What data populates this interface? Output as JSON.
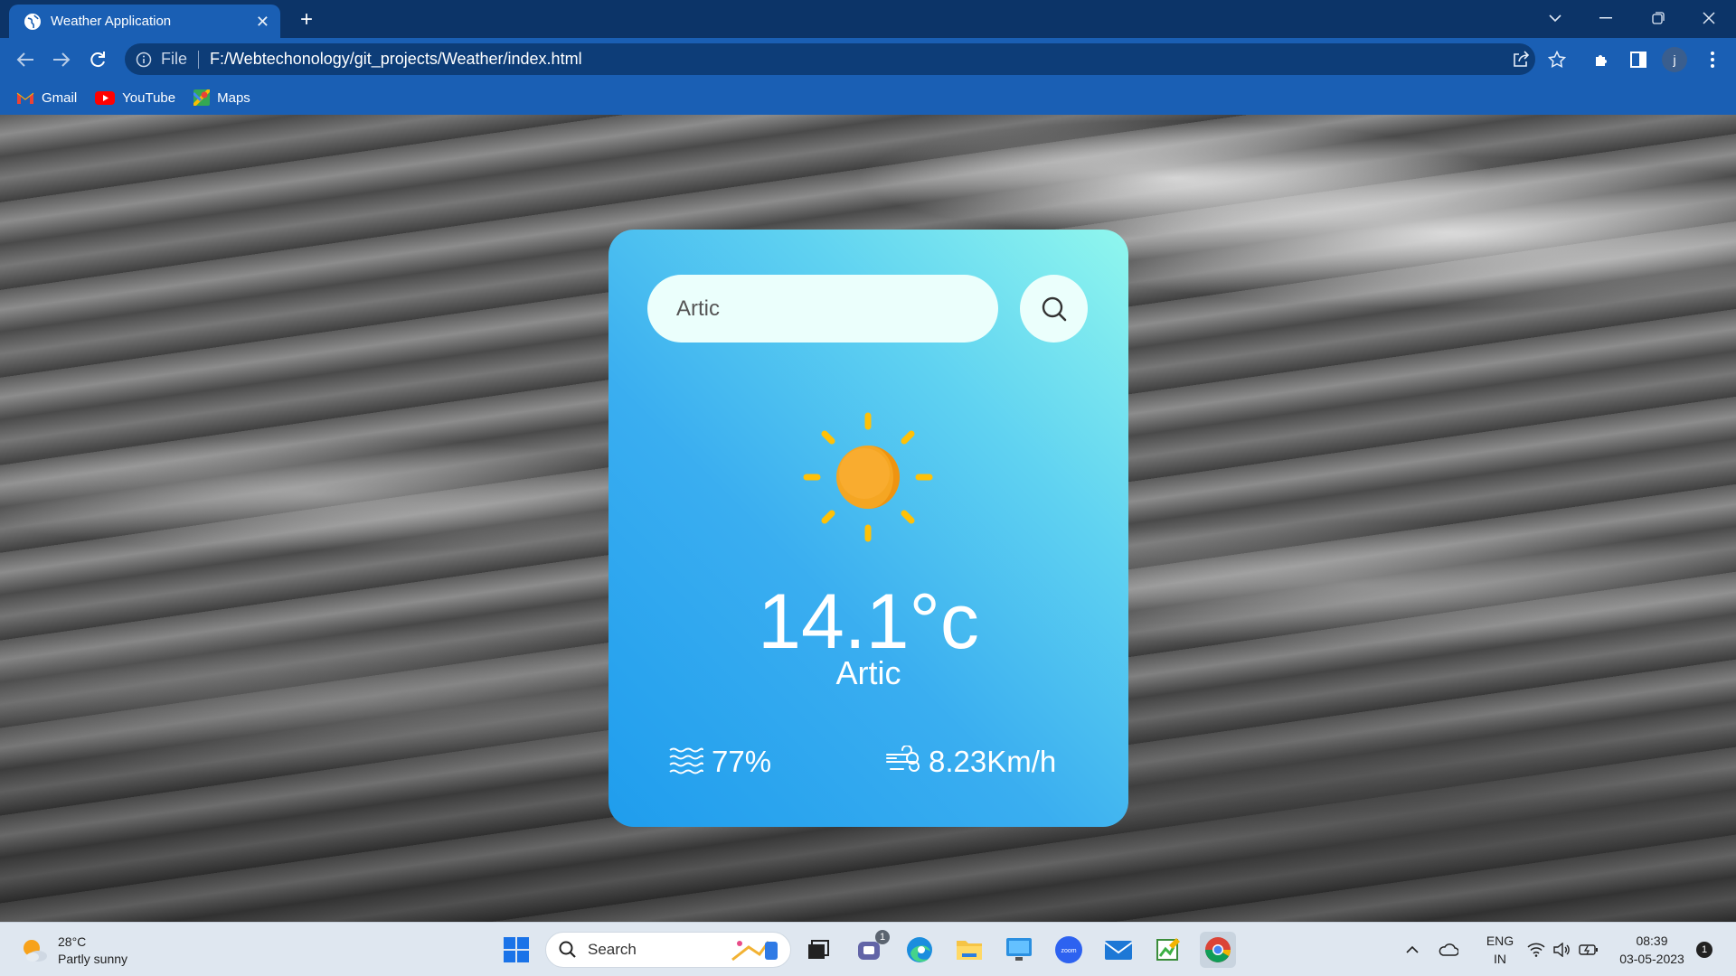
{
  "browser": {
    "tab_title": "Weather Application",
    "url_scheme_label": "File",
    "url": "F:/Webtechonology/git_projects/Weather/index.html",
    "profile_initial": "j",
    "bookmarks": [
      {
        "label": "Gmail",
        "icon": "gmail-icon"
      },
      {
        "label": "YouTube",
        "icon": "youtube-icon"
      },
      {
        "label": "Maps",
        "icon": "maps-icon"
      }
    ]
  },
  "weather_card": {
    "search_value": "Artic",
    "condition_icon": "sun-icon",
    "temperature": "14.1°c",
    "city": "Artic",
    "humidity": "77%",
    "wind_speed": "8.23Km/h",
    "colors": {
      "gradient_start": "#90f7ee",
      "gradient_end": "#1f9ded",
      "sun": "#f5a623",
      "rays": "#ffc107"
    }
  },
  "taskbar": {
    "weather_temp": "28°C",
    "weather_desc": "Partly sunny",
    "search_label": "Search",
    "language_top": "ENG",
    "language_bottom": "IN",
    "time": "08:39",
    "date": "03-05-2023",
    "notification_count": "1",
    "teams_badge": "1"
  }
}
